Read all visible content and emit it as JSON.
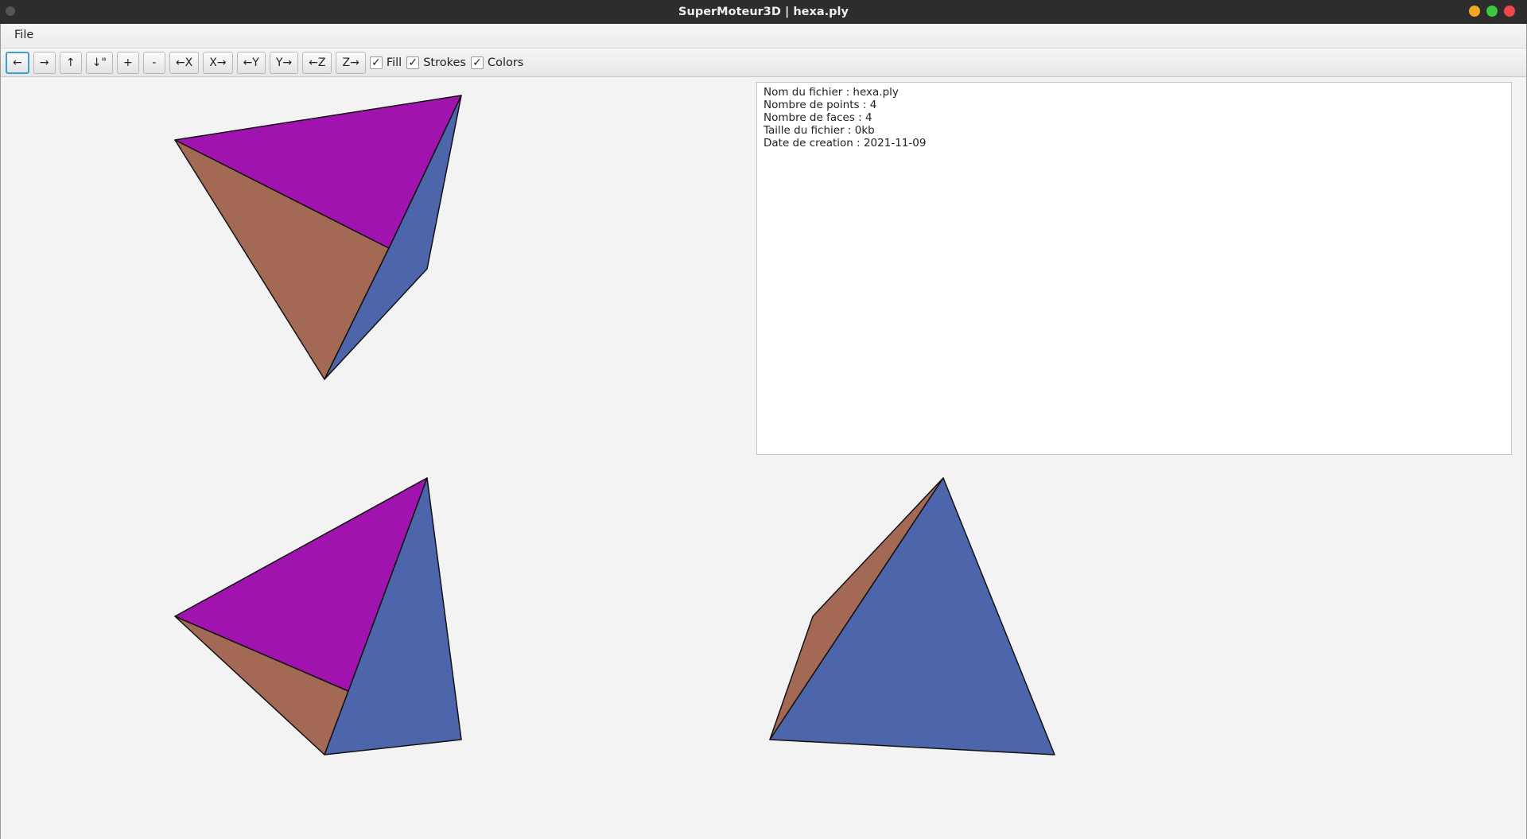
{
  "window": {
    "title": "SuperMoteur3D | hexa.ply",
    "controls": [
      {
        "name": "minimize",
        "color": "#f5a623"
      },
      {
        "name": "maximize",
        "color": "#3ec83e"
      },
      {
        "name": "close",
        "color": "#f04848"
      }
    ]
  },
  "menu": {
    "file": "File"
  },
  "toolbar": {
    "buttons": [
      "←",
      "→",
      "↑",
      "↓\"",
      "+",
      "-",
      "←X",
      "X→",
      "←Y",
      "Y→",
      "←Z",
      "Z→"
    ],
    "checkboxes": [
      {
        "label": "Fill",
        "checked": true,
        "mark": "✓"
      },
      {
        "label": "Strokes",
        "checked": true,
        "mark": "✓"
      },
      {
        "label": "Colors",
        "checked": true,
        "mark": "✓"
      }
    ]
  },
  "info": {
    "lines": [
      "Nom du fichier : hexa.ply",
      "Nombre de points : 4",
      "Nombre de faces : 4",
      "Taille du fichier : 0kb",
      "Date de creation : 2021-11-09"
    ]
  },
  "colors": {
    "face_purple": "#a013ae",
    "face_brown": "#a46955",
    "face_blue": "#4d65ab",
    "stroke": "#111111"
  }
}
